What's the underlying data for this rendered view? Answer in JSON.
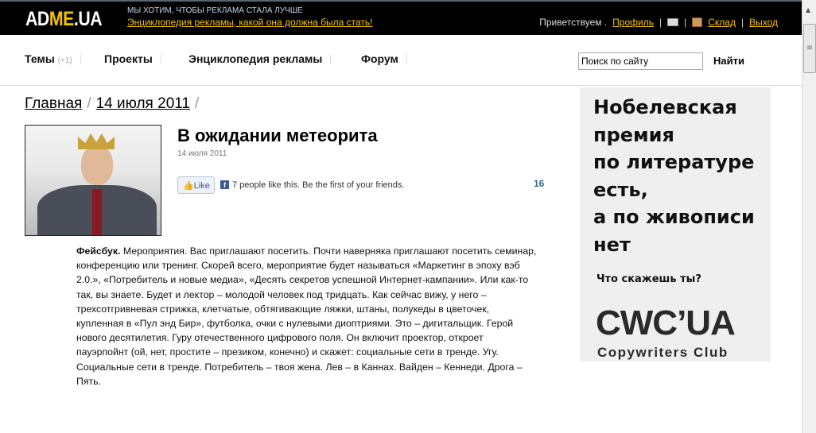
{
  "header": {
    "logo": {
      "ad": "AD",
      "me": "ME",
      "ua": ".UA"
    },
    "slogan": "МЫ ХОТИМ, ЧТОБЫ РЕКЛАМА СТАЛА ЛУЧШЕ",
    "tagline": "Энциклопедия рекламы, какой она должна была стать!",
    "greeting": "Приветствуем .",
    "profile": "Профиль",
    "warehouse": "Склад",
    "logout": "Выход"
  },
  "nav": {
    "items": [
      {
        "label": "Темы",
        "count": "(+1)"
      },
      {
        "label": "Проекты"
      },
      {
        "label": "Энциклопедия рекламы"
      },
      {
        "label": "Форум"
      }
    ],
    "search_value": "Поиск по сайту",
    "search_button": "Найти"
  },
  "breadcrumb": [
    "Главная",
    "14 июля 2011"
  ],
  "article": {
    "title": "В ожидании метеорита",
    "date": "14 июля 2011",
    "like_label": "Like",
    "like_text": "7 people like this. Be the first of your friends.",
    "count": "16",
    "lead": "Фейсбук.",
    "lines": [
      "Мероприятия. Вас приглашают посетить. Почти наверняка приглашают посетить семинар,",
      "конференцию или тренинг. Скорей всего, мероприятие будет называться «Маркетинг в эпоху вэб",
      "2.0.», «Потребитель и новые медиа», «Десять секретов успешной Интернет-кампании». Или как-то",
      "так, вы знаете. Будет и лектор – молодой человек под тридцать. Как сейчас вижу, у него –",
      "трехсотгривневая стрижка, клетчатые, обтягивающие ляжки, штаны, полукеды в цветочек,",
      "купленная в «Пул энд Бир», футболка, очки с нулевыми диоптриями. Это – дигитальщик. Герой",
      "нового десятилетия. Гуру отечественного цифрового поля. Он включит проектор, откроет",
      "пауэрпойнт (ой, нет, простите – презиком, конечно) и скажет: социальные сети в тренде. Угу.",
      "Социальные сети в тренде. Потребитель – твоя жена. Лев – в Каннах. Вайден – Кеннеди. Дрога –",
      "Пять."
    ]
  },
  "ad": {
    "lines": [
      "Нобелевская",
      "премия",
      "по литературе",
      "есть,",
      "а по живописи",
      "нет"
    ],
    "question": "Что скажешь ты?",
    "logo": "CWC’UA",
    "sub": "Copywriters Club"
  }
}
